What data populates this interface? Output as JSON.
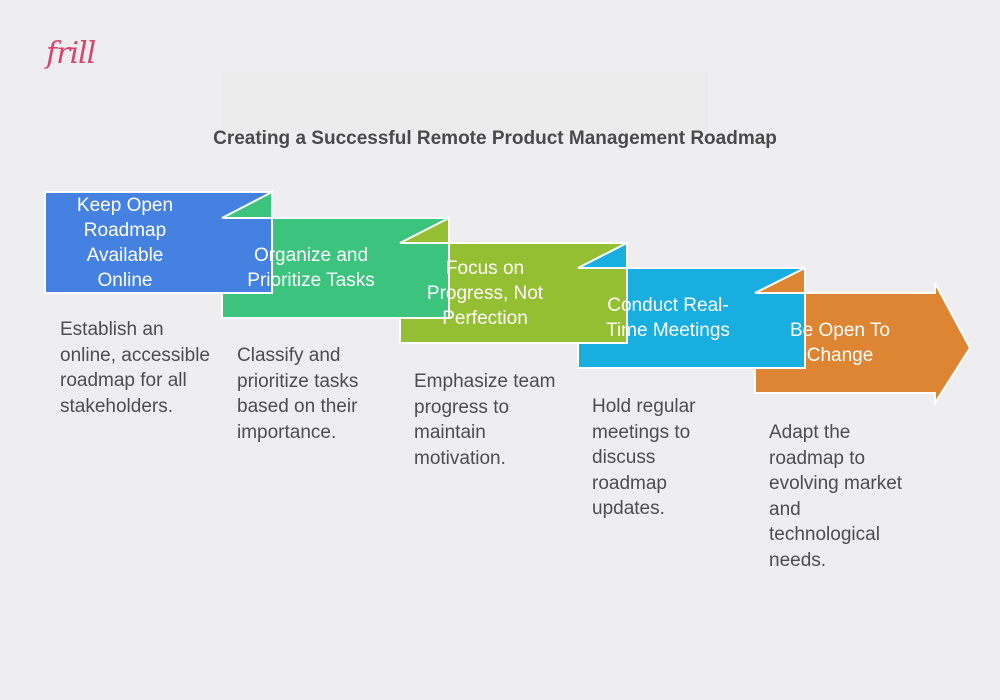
{
  "logo": {
    "text": "frill",
    "color": "#D9436C"
  },
  "title": "Creating a Successful Remote Product Management Roadmap",
  "steps": [
    {
      "label": "Keep Open Roadmap Available Online",
      "description": "Establish an online, accessible roadmap for all stakeholders.",
      "color": "#4581E0",
      "fold_color": "#3CC47F"
    },
    {
      "label": "Organize and Prioritize Tasks",
      "description": "Classify and prioritize tasks based on their importance.",
      "color": "#3CC47F",
      "fold_color": "#95BF33"
    },
    {
      "label": "Focus on Progress, Not Perfection",
      "description": "Emphasize team progress to maintain motivation.",
      "color": "#95BF33",
      "fold_color": "#19AEE0"
    },
    {
      "label": "Conduct Real-Time Meetings",
      "description": "Hold regular meetings to discuss roadmap updates.",
      "color": "#19AEE0",
      "fold_color": "#DE8533"
    },
    {
      "label": "Be Open To Change",
      "description": "Adapt the roadmap to evolving market and technological needs.",
      "color": "#DE8533",
      "shape": "arrow"
    }
  ]
}
